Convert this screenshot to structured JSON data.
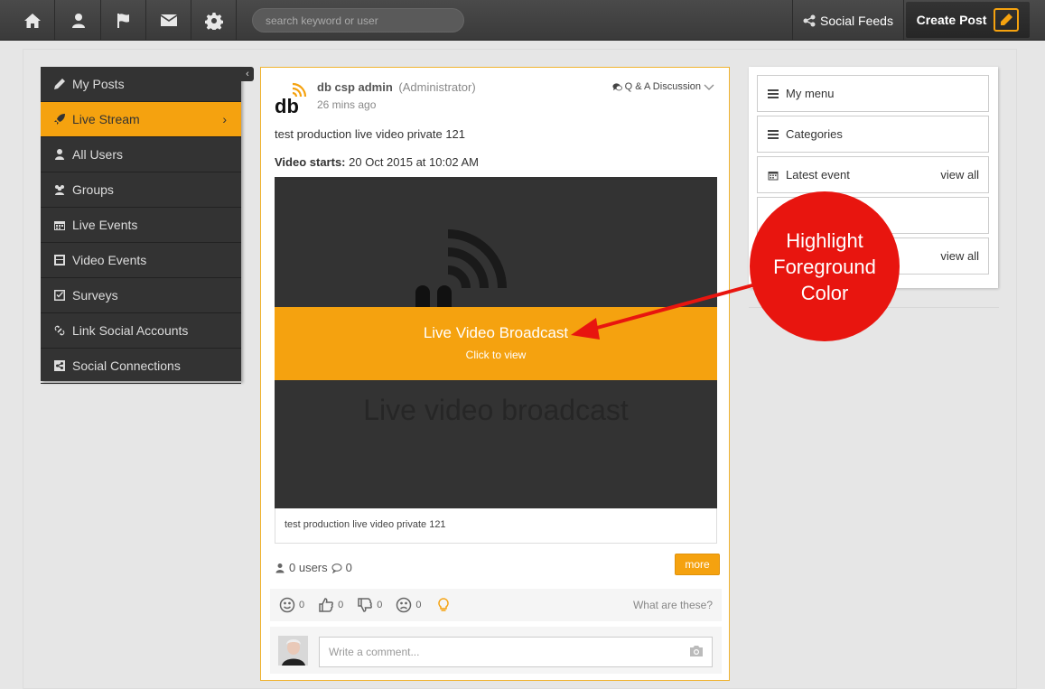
{
  "topbar": {
    "nav_icons": [
      "home-icon",
      "user-icon",
      "flag-icon",
      "envelope-icon",
      "gear-icon"
    ],
    "search_placeholder": "search keyword or user",
    "social_feeds_label": "Social Feeds",
    "create_post_label": "Create Post"
  },
  "sidebar": {
    "items": [
      {
        "label": "My Posts",
        "icon": "pencil-icon"
      },
      {
        "label": "Live Stream",
        "icon": "rocket-icon",
        "active": true
      },
      {
        "label": "All Users",
        "icon": "user-icon"
      },
      {
        "label": "Groups",
        "icon": "users-icon"
      },
      {
        "label": "Live Events",
        "icon": "calendar-icon"
      },
      {
        "label": "Video Events",
        "icon": "film-icon"
      },
      {
        "label": "Surveys",
        "icon": "check-square-icon"
      },
      {
        "label": "Link Social Accounts",
        "icon": "link-icon"
      },
      {
        "label": "Social Connections",
        "icon": "share-icon"
      }
    ],
    "active_chevron": "›",
    "collapse_glyph": "‹"
  },
  "post": {
    "author_name": "db csp admin",
    "author_role": "(Administrator)",
    "time": "26 mins ago",
    "category": "Q & A Discussion",
    "text": "test production live video private 121",
    "video_starts_label": "Video starts:",
    "video_starts_value": "20 Oct 2015 at 10:02 AM",
    "banner_title": "Live Video Broadcast",
    "banner_subtitle": "Click to view",
    "video_label": "Live video broadcast",
    "caption": "test production live video private 121",
    "users_count": "0 users",
    "comments_count": "0",
    "more_label": "more",
    "reactions": [
      {
        "icon": "smile-icon",
        "count": "0"
      },
      {
        "icon": "thumbs-up-icon",
        "count": "0"
      },
      {
        "icon": "thumbs-down-icon",
        "count": "0"
      },
      {
        "icon": "frown-icon",
        "count": "0"
      }
    ],
    "what_are_these": "What are these?",
    "comment_placeholder": "Write a comment..."
  },
  "right_panel": {
    "items": [
      {
        "label": "My menu",
        "icon": "bars-icon"
      },
      {
        "label": "Categories",
        "icon": "bars-icon"
      },
      {
        "label": "Latest event",
        "icon": "calendar-icon",
        "view_all": "view all"
      },
      {
        "label": "",
        "icon": ""
      },
      {
        "label": "",
        "icon": "",
        "view_all": "view all"
      }
    ]
  },
  "annotation": {
    "text_line1": "Highlight",
    "text_line2": "Foreground",
    "text_line3": "Color",
    "color": "#e8150f"
  },
  "colors": {
    "accent": "#f5a20f",
    "topbar": "#3f3f3f",
    "sidebar": "#333333"
  }
}
